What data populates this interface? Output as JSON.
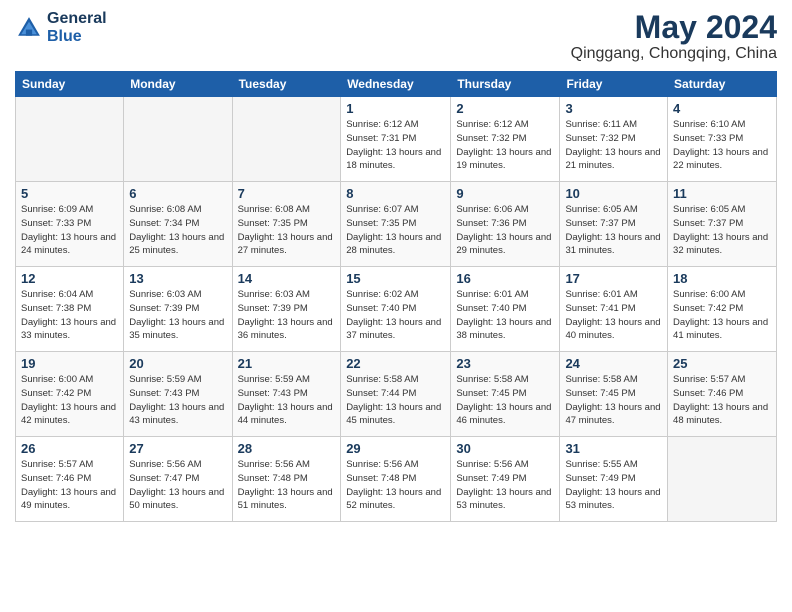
{
  "header": {
    "logo_line1": "General",
    "logo_line2": "Blue",
    "main_title": "May 2024",
    "subtitle": "Qinggang, Chongqing, China"
  },
  "days_of_week": [
    "Sunday",
    "Monday",
    "Tuesday",
    "Wednesday",
    "Thursday",
    "Friday",
    "Saturday"
  ],
  "weeks": [
    {
      "row_class": "row-white",
      "days": [
        {
          "date": "",
          "info": ""
        },
        {
          "date": "",
          "info": ""
        },
        {
          "date": "",
          "info": ""
        },
        {
          "date": "1",
          "info": "Sunrise: 6:12 AM\nSunset: 7:31 PM\nDaylight: 13 hours and 18 minutes."
        },
        {
          "date": "2",
          "info": "Sunrise: 6:12 AM\nSunset: 7:32 PM\nDaylight: 13 hours and 19 minutes."
        },
        {
          "date": "3",
          "info": "Sunrise: 6:11 AM\nSunset: 7:32 PM\nDaylight: 13 hours and 21 minutes."
        },
        {
          "date": "4",
          "info": "Sunrise: 6:10 AM\nSunset: 7:33 PM\nDaylight: 13 hours and 22 minutes."
        }
      ]
    },
    {
      "row_class": "row-alt",
      "days": [
        {
          "date": "5",
          "info": "Sunrise: 6:09 AM\nSunset: 7:33 PM\nDaylight: 13 hours and 24 minutes."
        },
        {
          "date": "6",
          "info": "Sunrise: 6:08 AM\nSunset: 7:34 PM\nDaylight: 13 hours and 25 minutes."
        },
        {
          "date": "7",
          "info": "Sunrise: 6:08 AM\nSunset: 7:35 PM\nDaylight: 13 hours and 27 minutes."
        },
        {
          "date": "8",
          "info": "Sunrise: 6:07 AM\nSunset: 7:35 PM\nDaylight: 13 hours and 28 minutes."
        },
        {
          "date": "9",
          "info": "Sunrise: 6:06 AM\nSunset: 7:36 PM\nDaylight: 13 hours and 29 minutes."
        },
        {
          "date": "10",
          "info": "Sunrise: 6:05 AM\nSunset: 7:37 PM\nDaylight: 13 hours and 31 minutes."
        },
        {
          "date": "11",
          "info": "Sunrise: 6:05 AM\nSunset: 7:37 PM\nDaylight: 13 hours and 32 minutes."
        }
      ]
    },
    {
      "row_class": "row-white",
      "days": [
        {
          "date": "12",
          "info": "Sunrise: 6:04 AM\nSunset: 7:38 PM\nDaylight: 13 hours and 33 minutes."
        },
        {
          "date": "13",
          "info": "Sunrise: 6:03 AM\nSunset: 7:39 PM\nDaylight: 13 hours and 35 minutes."
        },
        {
          "date": "14",
          "info": "Sunrise: 6:03 AM\nSunset: 7:39 PM\nDaylight: 13 hours and 36 minutes."
        },
        {
          "date": "15",
          "info": "Sunrise: 6:02 AM\nSunset: 7:40 PM\nDaylight: 13 hours and 37 minutes."
        },
        {
          "date": "16",
          "info": "Sunrise: 6:01 AM\nSunset: 7:40 PM\nDaylight: 13 hours and 38 minutes."
        },
        {
          "date": "17",
          "info": "Sunrise: 6:01 AM\nSunset: 7:41 PM\nDaylight: 13 hours and 40 minutes."
        },
        {
          "date": "18",
          "info": "Sunrise: 6:00 AM\nSunset: 7:42 PM\nDaylight: 13 hours and 41 minutes."
        }
      ]
    },
    {
      "row_class": "row-alt",
      "days": [
        {
          "date": "19",
          "info": "Sunrise: 6:00 AM\nSunset: 7:42 PM\nDaylight: 13 hours and 42 minutes."
        },
        {
          "date": "20",
          "info": "Sunrise: 5:59 AM\nSunset: 7:43 PM\nDaylight: 13 hours and 43 minutes."
        },
        {
          "date": "21",
          "info": "Sunrise: 5:59 AM\nSunset: 7:43 PM\nDaylight: 13 hours and 44 minutes."
        },
        {
          "date": "22",
          "info": "Sunrise: 5:58 AM\nSunset: 7:44 PM\nDaylight: 13 hours and 45 minutes."
        },
        {
          "date": "23",
          "info": "Sunrise: 5:58 AM\nSunset: 7:45 PM\nDaylight: 13 hours and 46 minutes."
        },
        {
          "date": "24",
          "info": "Sunrise: 5:58 AM\nSunset: 7:45 PM\nDaylight: 13 hours and 47 minutes."
        },
        {
          "date": "25",
          "info": "Sunrise: 5:57 AM\nSunset: 7:46 PM\nDaylight: 13 hours and 48 minutes."
        }
      ]
    },
    {
      "row_class": "row-white",
      "days": [
        {
          "date": "26",
          "info": "Sunrise: 5:57 AM\nSunset: 7:46 PM\nDaylight: 13 hours and 49 minutes."
        },
        {
          "date": "27",
          "info": "Sunrise: 5:56 AM\nSunset: 7:47 PM\nDaylight: 13 hours and 50 minutes."
        },
        {
          "date": "28",
          "info": "Sunrise: 5:56 AM\nSunset: 7:48 PM\nDaylight: 13 hours and 51 minutes."
        },
        {
          "date": "29",
          "info": "Sunrise: 5:56 AM\nSunset: 7:48 PM\nDaylight: 13 hours and 52 minutes."
        },
        {
          "date": "30",
          "info": "Sunrise: 5:56 AM\nSunset: 7:49 PM\nDaylight: 13 hours and 53 minutes."
        },
        {
          "date": "31",
          "info": "Sunrise: 5:55 AM\nSunset: 7:49 PM\nDaylight: 13 hours and 53 minutes."
        },
        {
          "date": "",
          "info": ""
        }
      ]
    }
  ]
}
